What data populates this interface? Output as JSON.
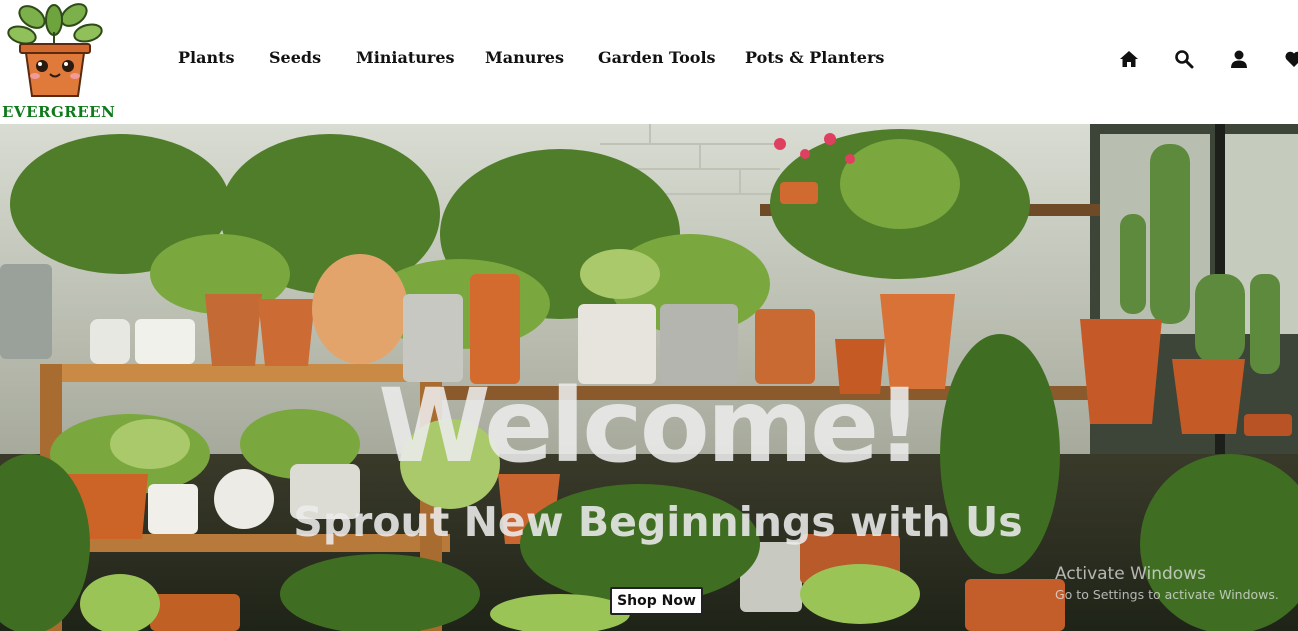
{
  "brand": {
    "name": "EVERGREEN",
    "color": "#0f7a1c",
    "logo_icon": "potted-plant-mascot-icon"
  },
  "nav": {
    "items": [
      {
        "label": "Plants"
      },
      {
        "label": "Seeds"
      },
      {
        "label": "Miniatures"
      },
      {
        "label": "Manures"
      },
      {
        "label": "Garden Tools"
      },
      {
        "label": "Pots & Planters"
      }
    ]
  },
  "header_icons": [
    "home-icon",
    "search-icon",
    "user-icon",
    "heart-icon"
  ],
  "hero": {
    "title": "Welcome!",
    "subtitle": "Sprout New Beginnings with Us",
    "cta_label": "Shop Now",
    "background": "potted-plants-on-wooden-shelves-photo"
  },
  "watermark": {
    "line1": "Activate Windows",
    "line2": "Go to Settings to activate Windows."
  }
}
